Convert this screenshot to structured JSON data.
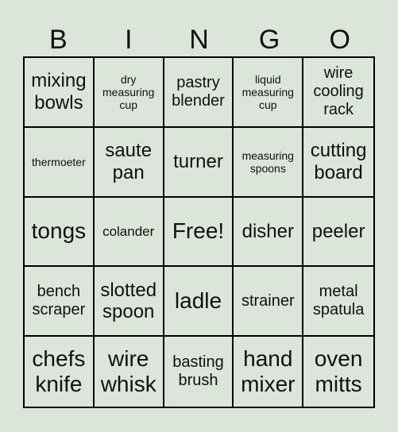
{
  "header": [
    "B",
    "I",
    "N",
    "G",
    "O"
  ],
  "cells": [
    {
      "text": "mixing bowls",
      "size": "lg"
    },
    {
      "text": "dry measuring cup",
      "size": "xs"
    },
    {
      "text": "pastry blender",
      "size": "md"
    },
    {
      "text": "liquid measuring cup",
      "size": "xs"
    },
    {
      "text": "wire cooling rack",
      "size": "md"
    },
    {
      "text": "thermoeter",
      "size": "xs"
    },
    {
      "text": "saute pan",
      "size": "lg"
    },
    {
      "text": "turner",
      "size": "lg"
    },
    {
      "text": "measuring spoons",
      "size": "xs"
    },
    {
      "text": "cutting board",
      "size": "lg"
    },
    {
      "text": "tongs",
      "size": "xl"
    },
    {
      "text": "colander",
      "size": "sm"
    },
    {
      "text": "Free!",
      "size": "xl"
    },
    {
      "text": "disher",
      "size": "lg"
    },
    {
      "text": "peeler",
      "size": "lg"
    },
    {
      "text": "bench scraper",
      "size": "md"
    },
    {
      "text": "slotted spoon",
      "size": "lg"
    },
    {
      "text": "ladle",
      "size": "xl"
    },
    {
      "text": "strainer",
      "size": "md"
    },
    {
      "text": "metal spatula",
      "size": "md"
    },
    {
      "text": "chefs knife",
      "size": "xl"
    },
    {
      "text": "wire whisk",
      "size": "xl"
    },
    {
      "text": "basting brush",
      "size": "md"
    },
    {
      "text": "hand mixer",
      "size": "xl"
    },
    {
      "text": "oven mitts",
      "size": "xl"
    }
  ]
}
